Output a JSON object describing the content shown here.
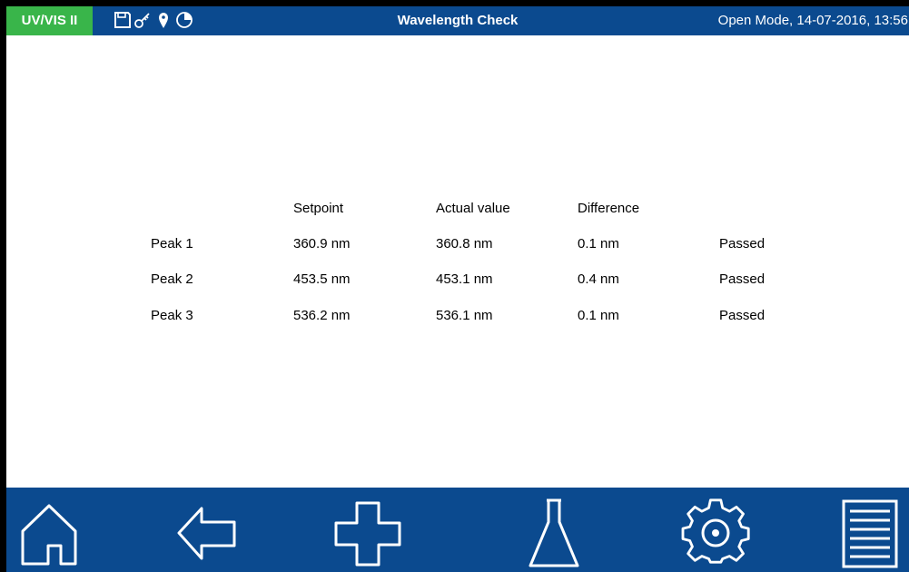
{
  "header": {
    "badge": "UV/VIS II",
    "title": "Wavelength Check",
    "mode_timestamp": "Open Mode, 14-07-2016, 13:56",
    "status_icons": [
      "save-icon",
      "key-icon",
      "location-pin-icon",
      "pie-timer-icon"
    ]
  },
  "results": {
    "columns": [
      "Setpoint",
      "Actual value",
      "Difference"
    ],
    "rows": [
      {
        "label": "Peak 1",
        "setpoint": "360.9 nm",
        "actual": "360.8 nm",
        "difference": "0.1 nm",
        "status": "Passed"
      },
      {
        "label": "Peak 2",
        "setpoint": "453.5 nm",
        "actual": "453.1 nm",
        "difference": "0.4 nm",
        "status": "Passed"
      },
      {
        "label": "Peak 3",
        "setpoint": "536.2 nm",
        "actual": "536.1 nm",
        "difference": "0.1 nm",
        "status": "Passed"
      }
    ]
  },
  "navbar": {
    "buttons": [
      "home-icon",
      "back-arrow-icon",
      "plus-icon",
      "flask-icon",
      "settings-gear-icon",
      "menu-list-icon"
    ]
  },
  "colors": {
    "bar_blue": "#0b4a8f",
    "badge_green": "#39b54a",
    "background": "#ffffff"
  }
}
